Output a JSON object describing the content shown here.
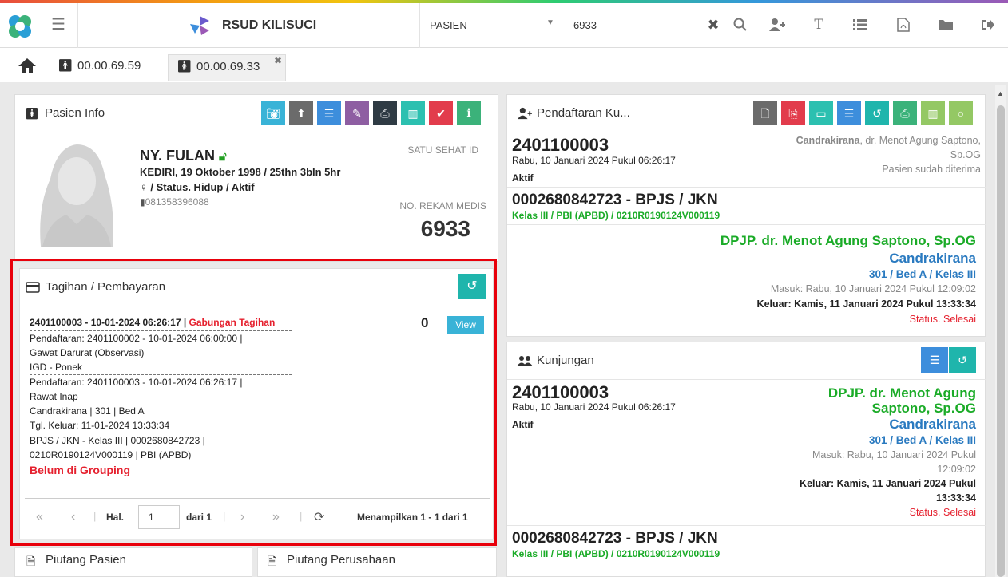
{
  "header": {
    "app_name": "RSUD KILISUCI",
    "search_type": "PASIEN",
    "search_value": "6933"
  },
  "tabs": [
    {
      "label": "00.00.69.59"
    },
    {
      "label": "00.00.69.33"
    }
  ],
  "pasien_info": {
    "title": "Pasien Info",
    "name": "NY. FULAN",
    "birth": "KEDIRI, 19 Oktober 1998 / 25thn 3bln 5hr",
    "status": "/ Status. Hidup / Aktif",
    "phone": "081358396088",
    "satu_sehat_label": "SATU SEHAT ID",
    "rm_label": "NO. REKAM MEDIS",
    "rm_value": "6933"
  },
  "tagihan": {
    "title": "Tagihan / Pembayaran",
    "item_code": "2401100003 - 10-01-2024 06:26:17 |",
    "item_type": "Gabungan Tagihan",
    "amount": "0",
    "view_label": "View",
    "lines": [
      "Pendaftaran: 2401100002 - 10-01-2024 06:00:00 |",
      "Gawat Darurat (Observasi)",
      "IGD - Ponek",
      "Pendaftaran: 2401100003 - 10-01-2024 06:26:17 |",
      "Rawat Inap",
      "Candrakirana | 301 | Bed A",
      "Tgl. Keluar: 11-01-2024 13:33:34",
      "BPJS / JKN - Kelas III | 0002680842723 |",
      "0210R0190124V000119 | PBI (APBD)"
    ],
    "grouping": "Belum di Grouping",
    "pager": {
      "hal_label": "Hal.",
      "page": "1",
      "of_label": "dari 1",
      "summary": "Menampilkan 1 - 1 dari 1"
    }
  },
  "piutang_pasien": {
    "title": "Piutang Pasien"
  },
  "piutang_perusahaan": {
    "title": "Piutang Perusahaan"
  },
  "pendaftaran": {
    "title": "Pendaftaran Ku...",
    "reg_no": "2401100003",
    "reg_date": "Rabu, 10 Januari 2024 Pukul 06:26:17",
    "reg_status": "Aktif",
    "unit_name": "Candrakirana",
    "doctor_short": ", dr. Menot Agung Saptono,",
    "doctor_suffix": "Sp.OG",
    "accepted": "Pasien sudah diterima",
    "bpjs": "0002680842723 - BPJS / JKN",
    "bpjs_detail": "Kelas III / PBI (APBD) / 0210R0190124V000119",
    "dpjp": "DPJP. dr. Menot Agung Saptono, Sp.OG",
    "ward": "Candrakirana",
    "bed": "301 / Bed A / Kelas III",
    "masuk": "Masuk: Rabu, 10 Januari 2024 Pukul 12:09:02",
    "keluar": "Keluar: Kamis, 11 Januari 2024 Pukul 13:33:34",
    "status": "Status. Selesai"
  },
  "kunjungan": {
    "title": "Kunjungan",
    "reg_no": "2401100003",
    "reg_date": "Rabu, 10 Januari 2024 Pukul 06:26:17",
    "reg_status": "Aktif",
    "dpjp_1": "DPJP. dr. Menot Agung",
    "dpjp_2": "Saptono, Sp.OG",
    "ward": "Candrakirana",
    "bed": "301 / Bed A / Kelas III",
    "masuk_1": "Masuk: Rabu, 10 Januari 2024 Pukul",
    "masuk_2": "12:09:02",
    "keluar_1": "Keluar: Kamis, 11 Januari 2024 Pukul",
    "keluar_2": "13:33:34",
    "status": "Status. Selesai",
    "bpjs": "0002680842723 - BPJS / JKN",
    "bpjs_detail": "Kelas III / PBI (APBD) / 0210R0190124V000119"
  },
  "colors": {
    "highlight_border": "#e8000b",
    "accent_teal": "#1fb5ac",
    "status_red": "#e5202e",
    "dpjp_green": "#1aab27",
    "ward_blue": "#2a7ac0"
  }
}
